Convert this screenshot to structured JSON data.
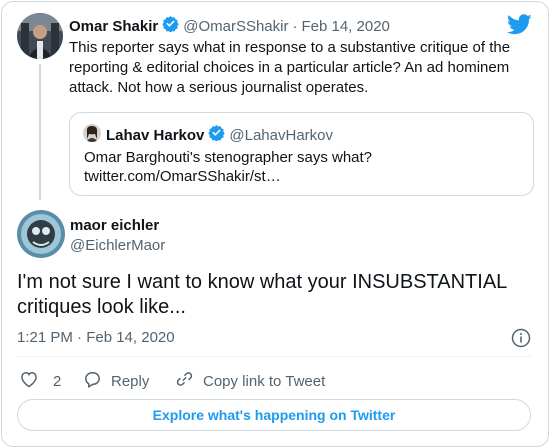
{
  "colors": {
    "accent": "#1d9bf0",
    "muted": "#536471",
    "border": "#cfd9de"
  },
  "original_tweet": {
    "author_name": "Omar Shakir",
    "handle": "@OmarSShakir",
    "separator": "·",
    "date": "Feb 14, 2020",
    "text": "This reporter says what in response to a substantive critique of the reporting & editorial choices in a particular article? An ad hominem attack. Not how a serious journalist operates."
  },
  "quoted_tweet": {
    "author_name": "Lahav Harkov",
    "handle": "@LahavHarkov",
    "text_line1": "Omar Barghouti's stenographer says what?",
    "text_line2": "twitter.com/OmarSShakir/st…"
  },
  "main_tweet": {
    "author_name": "maor eichler",
    "handle": "@EichlerMaor",
    "text": "I'm not sure I want to know what your INSUBSTANTIAL critiques look like...",
    "timestamp": "1:21 PM · Feb 14, 2020"
  },
  "actions": {
    "like_count": "2",
    "reply_label": "Reply",
    "copy_label": "Copy link to Tweet"
  },
  "footer": {
    "explore_label": "Explore what's happening on Twitter"
  },
  "icons": [
    "twitter-bird-icon",
    "verified-badge-icon",
    "info-icon",
    "heart-icon",
    "reply-icon",
    "link-icon"
  ]
}
